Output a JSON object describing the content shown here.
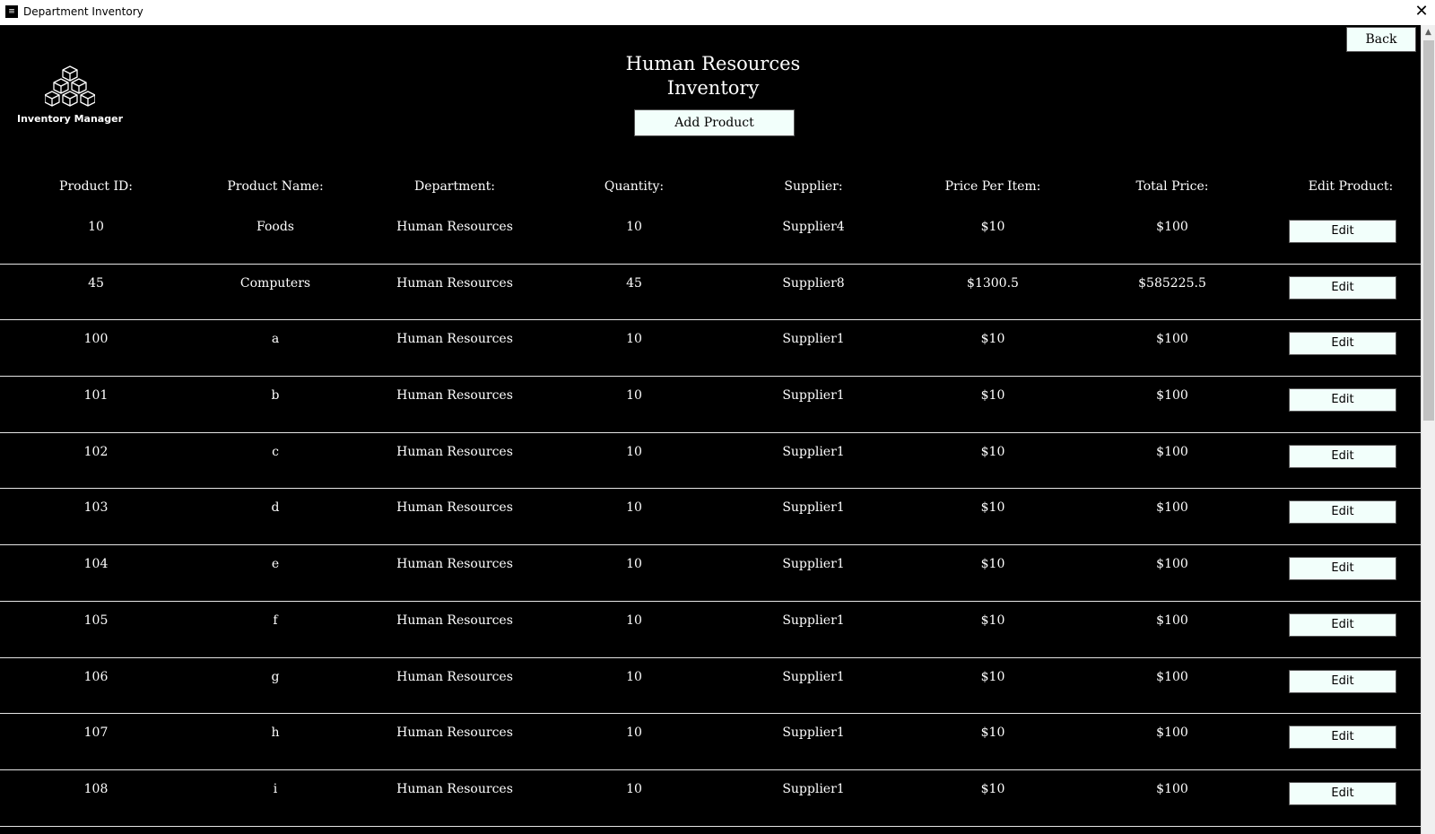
{
  "window": {
    "title": "Department Inventory",
    "app_icon_glyph": "≡",
    "close_glyph": "✕"
  },
  "header": {
    "back_label": "Back",
    "logo_text": "Inventory Manager",
    "title_line1": "Human Resources",
    "title_line2": "Inventory",
    "add_product_label": "Add Product"
  },
  "table": {
    "columns": [
      "Product ID:",
      "Product Name:",
      "Department:",
      "Quantity:",
      "Supplier:",
      "Price Per Item:",
      "Total Price:",
      "Edit Product:"
    ],
    "edit_label": "Edit",
    "rows": [
      [
        "10",
        "Foods",
        "Human Resources",
        "10",
        "Supplier4",
        "$10",
        "$100"
      ],
      [
        "45",
        "Computers",
        "Human Resources",
        "45",
        "Supplier8",
        "$1300.5",
        "$585225.5"
      ],
      [
        "100",
        "a",
        "Human Resources",
        "10",
        "Supplier1",
        "$10",
        "$100"
      ],
      [
        "101",
        "b",
        "Human Resources",
        "10",
        "Supplier1",
        "$10",
        "$100"
      ],
      [
        "102",
        "c",
        "Human Resources",
        "10",
        "Supplier1",
        "$10",
        "$100"
      ],
      [
        "103",
        "d",
        "Human Resources",
        "10",
        "Supplier1",
        "$10",
        "$100"
      ],
      [
        "104",
        "e",
        "Human Resources",
        "10",
        "Supplier1",
        "$10",
        "$100"
      ],
      [
        "105",
        "f",
        "Human Resources",
        "10",
        "Supplier1",
        "$10",
        "$100"
      ],
      [
        "106",
        "g",
        "Human Resources",
        "10",
        "Supplier1",
        "$10",
        "$100"
      ],
      [
        "107",
        "h",
        "Human Resources",
        "10",
        "Supplier1",
        "$10",
        "$100"
      ],
      [
        "108",
        "i",
        "Human Resources",
        "10",
        "Supplier1",
        "$10",
        "$100"
      ]
    ]
  },
  "colors": {
    "background": "#000000",
    "button_fill": "#f2fffb",
    "text": "#ffffff"
  }
}
